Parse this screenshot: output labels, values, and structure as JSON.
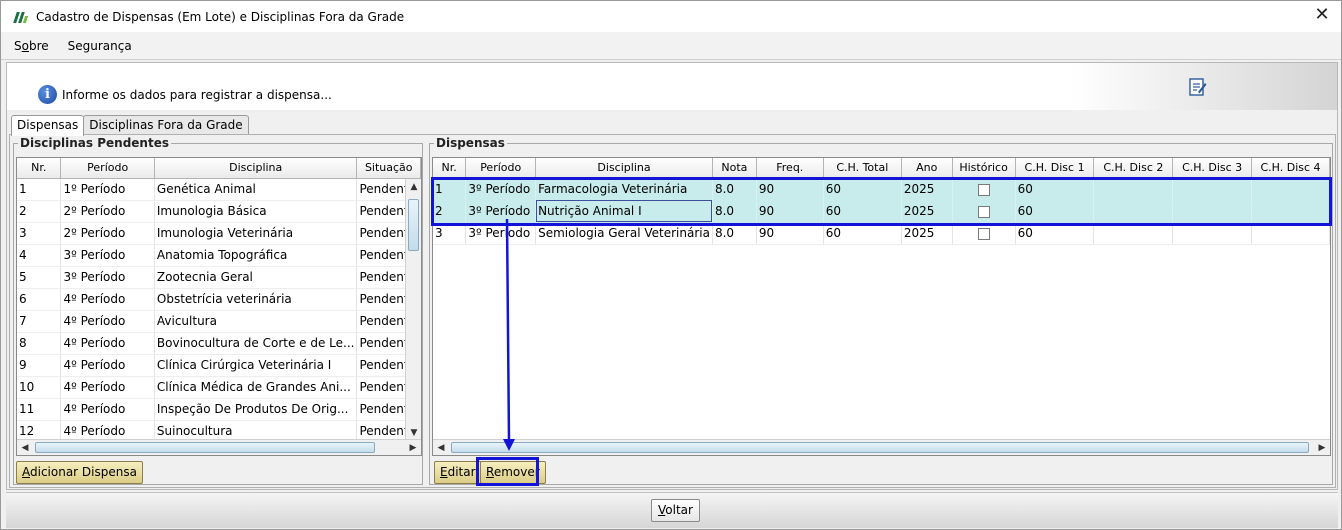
{
  "window": {
    "title": "Cadastro de Dispensas (Em Lote) e Disciplinas Fora da Grade",
    "close_glyph": "✕"
  },
  "menu": [
    {
      "label_pre": "S",
      "label_key": "o",
      "label_post": "bre"
    },
    {
      "label_pre": "",
      "label_key": "",
      "label_post": "Segurança"
    }
  ],
  "banner": {
    "info_text": "Informe os dados para registrar a dispensa..."
  },
  "tabs": [
    {
      "label": "Dispensas",
      "active": true
    },
    {
      "label": "Disciplinas Fora da Grade",
      "active": false
    }
  ],
  "pendentes": {
    "legend": "Disciplinas Pendentes",
    "columns": [
      "Nr.",
      "Período",
      "Disciplina",
      "Situação"
    ],
    "rows": [
      [
        "1",
        "1º Período",
        "Genética Animal",
        "Pendente"
      ],
      [
        "2",
        "2º Período",
        " Imunologia Básica",
        "Pendente"
      ],
      [
        "3",
        "2º Período",
        "Imunologia Veterinária",
        "Pendente"
      ],
      [
        "4",
        "3º Período",
        "Anatomia Topográfica",
        "Pendente"
      ],
      [
        "5",
        "3º Período",
        "Zootecnia Geral",
        "Pendente"
      ],
      [
        "6",
        "4º Período",
        " Obstetrícia veterinária",
        "Pendente"
      ],
      [
        "7",
        "4º Período",
        "Avicultura",
        "Pendente"
      ],
      [
        "8",
        "4º Período",
        "Bovinocultura de Corte e de Le...",
        "Pendente"
      ],
      [
        "9",
        "4º Período",
        "Clínica Cirúrgica Veterinária I",
        "Pendente"
      ],
      [
        "10",
        "4º Período",
        "Clínica Médica de Grandes Ani...",
        "Pendente"
      ],
      [
        "11",
        "4º Período",
        "Inspeção De Produtos De Orig...",
        "Pendente"
      ],
      [
        "12",
        "4º Período",
        "Suinocultura",
        "Pendente"
      ]
    ],
    "add_button": {
      "pre": "",
      "key": "A",
      "post": "dicionar Dispensa"
    }
  },
  "dispensas": {
    "legend": "Dispensas",
    "columns": [
      "Nr.",
      "Período",
      "Disciplina",
      "Nota",
      "Freq.",
      "C.H. Total",
      "Ano",
      "Histórico",
      "C.H. Disc 1",
      "C.H. Disc 2",
      "C.H. Disc 3",
      "C.H. Disc 4"
    ],
    "rows": [
      {
        "nr": "1",
        "periodo": "3º Período",
        "disciplina": "Farmacologia Veterinária",
        "nota": "8.0",
        "freq": "90",
        "ch_total": "60",
        "ano": "2025",
        "historico": false,
        "ch1": "60",
        "ch2": "",
        "ch3": "",
        "ch4": "",
        "selected": true
      },
      {
        "nr": "2",
        "periodo": "3º Período",
        "disciplina": "Nutrição Animal I",
        "nota": "8.0",
        "freq": "90",
        "ch_total": "60",
        "ano": "2025",
        "historico": false,
        "ch1": "60",
        "ch2": "",
        "ch3": "",
        "ch4": "",
        "selected": true
      },
      {
        "nr": "3",
        "periodo": "3º Período",
        "disciplina": "Semiologia Geral Veterinária",
        "nota": "8.0",
        "freq": "90",
        "ch_total": "60",
        "ano": "2025",
        "historico": false,
        "ch1": "60",
        "ch2": "",
        "ch3": "",
        "ch4": "",
        "selected": false
      }
    ],
    "edit_button": {
      "pre": "",
      "key": "E",
      "post": "ditar"
    },
    "remove_button": {
      "pre": "",
      "key": "R",
      "post": "emover"
    }
  },
  "footer": {
    "back_button": {
      "pre": "",
      "key": "V",
      "post": "oltar"
    }
  },
  "colors": {
    "selection": "#c8eceb",
    "annotation": "#1414d8",
    "button_gold": "#dccd86"
  },
  "icons": [
    "app-logo-icon",
    "close-icon",
    "info-icon",
    "edit-document-icon",
    "scroll-up-icon",
    "scroll-down-icon",
    "scroll-left-icon",
    "scroll-right-icon"
  ]
}
